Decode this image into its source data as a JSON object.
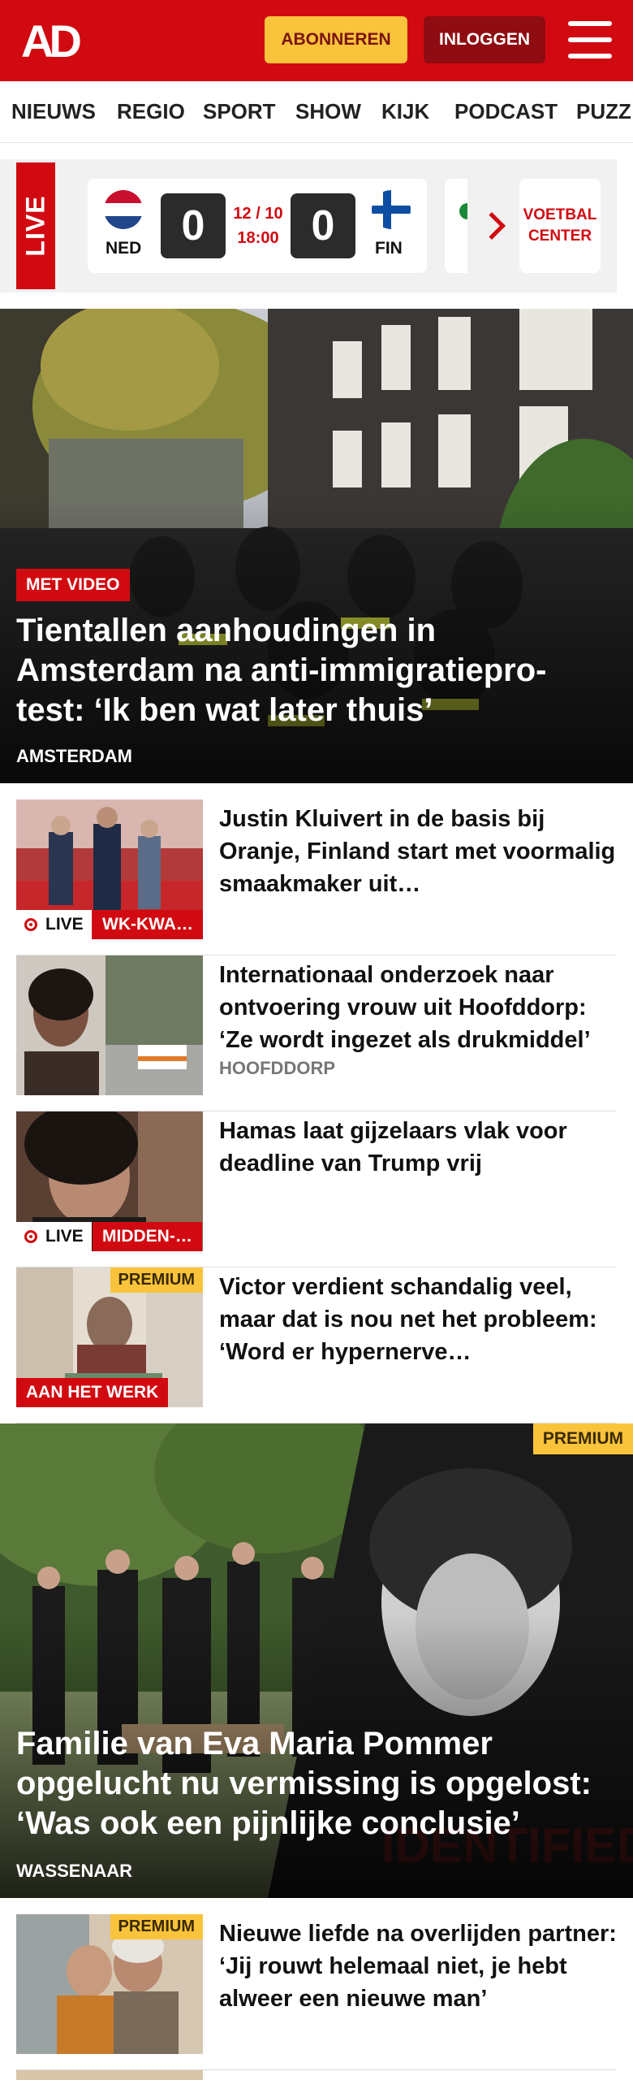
{
  "header": {
    "logo": "AD",
    "subscribe_label": "ABONNEREN",
    "login_label": "INLOGGEN",
    "menu_icon": "hamburger-menu-icon",
    "brand_color": "#d10a11"
  },
  "nav": {
    "items": [
      "NIEUWS",
      "REGIO",
      "SPORT",
      "SHOW",
      "KIJK",
      "PODCAST",
      "PUZZ"
    ]
  },
  "live_scores": {
    "live_label": "LIVE",
    "match": {
      "home_team": "NED",
      "away_team": "FIN",
      "home_score": "0",
      "away_score": "0",
      "date": "12 / 10",
      "time": "18:00"
    },
    "voetbal_center_label": "VOETBAL CENTER"
  },
  "articles": [
    {
      "badge": "MET VIDEO",
      "title": "Tientallen aanhoudingen in Amsterdam na anti-immigratiepro­test: ‘Ik ben wat later thuis’",
      "location": "AMSTERDAM"
    },
    {
      "title": "Justin Kluivert in de basis bij Oranje, Finland start met voormalig smaakmaker uit…",
      "live_label": "LIVE",
      "category": "WK-KWA…"
    },
    {
      "title": "Internationaal onderzoek naar ontvoering vrouw uit Hoofddorp: ‘Ze wordt ingezet als drukmiddel’",
      "location": "HOOFDDORP"
    },
    {
      "title": "Hamas laat gijzelaars vlak voor deadline van Trump vrij",
      "live_label": "LIVE",
      "category": "MIDDEN-…"
    },
    {
      "title": "Victor verdient schandalig veel, maar dat is nou net het probleem: ‘Word er hypernerve…",
      "premium": "PREMIUM",
      "category": "AAN HET WERK"
    },
    {
      "premium": "PREMIUM",
      "title": "Familie van Eva Maria Pommer opgelucht nu vermissing is opgelost: ‘Was ook een pijnlijke conclusie’",
      "location": "WASSENAAR"
    },
    {
      "title": "Nieuwe liefde na overlijden partner: ‘Jij rouwt helemaal niet, je hebt alweer een nieuwe man’",
      "premium": "PREMIUM"
    }
  ]
}
